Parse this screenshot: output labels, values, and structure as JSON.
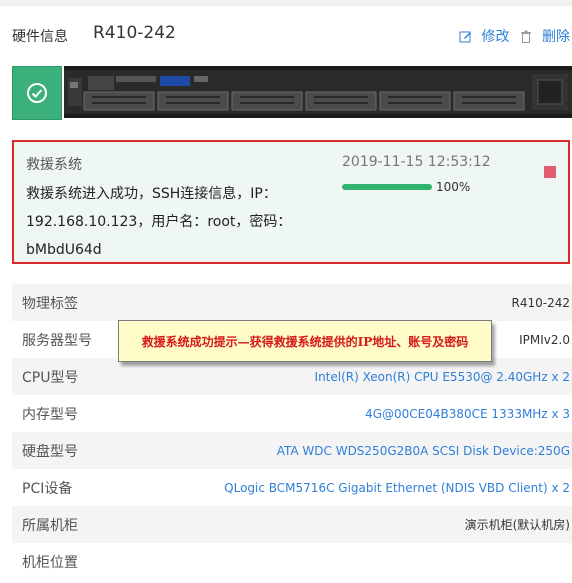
{
  "header": {
    "label": "硬件信息",
    "hostname": "R410-242",
    "edit_label": "修改",
    "delete_label": "删除"
  },
  "rescue": {
    "title": "救援系统",
    "timestamp": "2019-11-15 12:53:12",
    "message": "救援系统进入成功，SSH连接信息，IP：192.168.10.123，用户名：root，密码：bMbdU64d",
    "progress": 1.0,
    "progress_label": "100%",
    "progress_color": "#2fb36e",
    "border_color": "#d82a2a"
  },
  "info_rows": [
    {
      "key": "物理标签",
      "value": "R410-242"
    },
    {
      "key": "服务器型号",
      "value": "IPMIv2.0"
    },
    {
      "key": "CPU型号",
      "value": "Intel(R) Xeon(R) CPU E5530@ 2.40GHz x 2"
    },
    {
      "key": "内存型号",
      "value": "4G@00CE04B380CE 1333MHz x 3"
    },
    {
      "key": "硬盘型号",
      "value": "ATA WDC  WDS250G2B0A SCSI Disk Device:250G"
    },
    {
      "key": "PCI设备",
      "value": "QLogic BCM5716C Gigabit Ethernet (NDIS VBD Client) x 2"
    },
    {
      "key": "所属机柜",
      "value": "演示机柜(默认机房)"
    },
    {
      "key": "机柜位置",
      "value": ""
    }
  ],
  "callout": {
    "text": "救援系统成功提示—获得救援系统提供的IP地址、账号及密码"
  }
}
